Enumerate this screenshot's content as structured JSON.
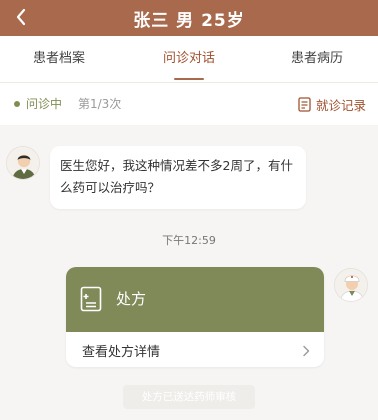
{
  "header": {
    "title": "张三  男  25岁",
    "background": "#a9694c",
    "back_icon": "chevron-left-icon"
  },
  "tabs": [
    {
      "label": "患者档案",
      "active": false
    },
    {
      "label": "问诊对话",
      "active": true
    },
    {
      "label": "患者病历",
      "active": false
    }
  ],
  "status": {
    "state": "问诊中",
    "count": "第1/3次",
    "records_label": "就诊记录",
    "records_icon": "document-list-icon",
    "accent": "#7f8f53"
  },
  "chat": {
    "patient_message": "医生您好，我这种情况差不多2周了，有什么药可以治疗吗？",
    "timestamp": "下午12:59",
    "prescription": {
      "title": "处方",
      "icon": "prescription-doc-icon",
      "detail_label": "查看处方详情",
      "header_color": "#7f8a58"
    },
    "sent_notice": "处方已送达药师审核"
  }
}
